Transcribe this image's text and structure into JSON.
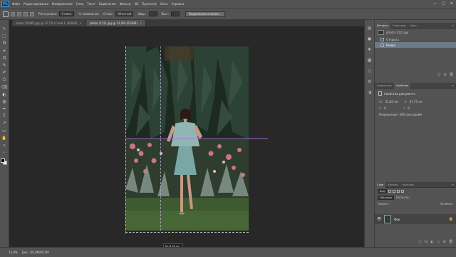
{
  "app": {
    "logo": "Ps"
  },
  "menu": [
    "Файл",
    "Редактирование",
    "Изображение",
    "Слои",
    "Текст",
    "Выделение",
    "Фильтр",
    "3D",
    "Просмотр",
    "Окно",
    "Справка"
  ],
  "window_controls": {
    "minimize": "—",
    "maximize": "□",
    "close": "✕"
  },
  "options": {
    "smooth_label": "Растушевка:",
    "smooth_value": "0 пикс.",
    "antialias": "Сглаживание",
    "style_label": "Стиль:",
    "style_value": "Обычный",
    "width_label": "Шир.:",
    "height_label": "Выс.:",
    "select_mask_button": "Выделение и маска..."
  },
  "tabs": [
    {
      "label": "photo (5066).jpg @ 12,7% (Слой 1, RGB/8)",
      "close": "×",
      "active": false
    },
    {
      "label": "photo (112).jpg @ 12,9% (RGB/8)",
      "close": "×",
      "active": true
    }
  ],
  "tools": [
    "↖",
    "⬚",
    "ʘ",
    "⌗",
    "⊡",
    "✎",
    "✐",
    "⎋",
    "⌫",
    "◐",
    "◍",
    "✒",
    "T",
    "↗",
    "▭",
    "✋",
    "⌕",
    "⋯"
  ],
  "right_strip_tools": [
    "▤",
    "◼",
    "❖",
    "▦",
    "◇",
    "⚙",
    "◑"
  ],
  "history": {
    "tabs": [
      "История",
      "Операции",
      "Цвет"
    ],
    "menu": "≡",
    "snapshot_label": "photo (112).jpg",
    "items": [
      "Открыть",
      "Рамка"
    ],
    "selected_index": 1,
    "footer_icons": [
      "◫",
      "⊕",
      "🗑"
    ]
  },
  "properties": {
    "tabs": [
      "Коррекция",
      "Свойства"
    ],
    "menu": "≡",
    "title": "Свойства документа",
    "w_label": "Ш:",
    "w_value": "31,83 см",
    "h_label": "В:",
    "h_value": "47,75 см",
    "x_label": "X:",
    "x_value": "0",
    "y_label": "Y:",
    "y_value": "0",
    "resolution": "Разрешение: 300 пикс/дюйм"
  },
  "layers": {
    "tabs": [
      "Слои",
      "Каналы",
      "Контуры"
    ],
    "menu": "≡",
    "filter_kind": "Вид",
    "mode": "Обычные",
    "opacity_label": "Непрозр.:",
    "lock_label": "Закреп.:",
    "fill_label": "Заливка:",
    "layer_name": "Фон",
    "eye": "👁",
    "lock": "🔒",
    "footer_icons": [
      "ⓕ",
      "fx",
      "◐",
      "▭",
      "⊕",
      "🗑"
    ]
  },
  "status": {
    "zoom": "12,9%",
    "doc": "Док.: 60,0M/60,0M",
    "tooltip_w": "Ш: 8,90 см",
    "tooltip_h": "В: 47,75 см"
  },
  "colors": {
    "accent": "#3fa9f5",
    "selected_row": "#6d7a8a",
    "guide": "#b06ee0"
  }
}
